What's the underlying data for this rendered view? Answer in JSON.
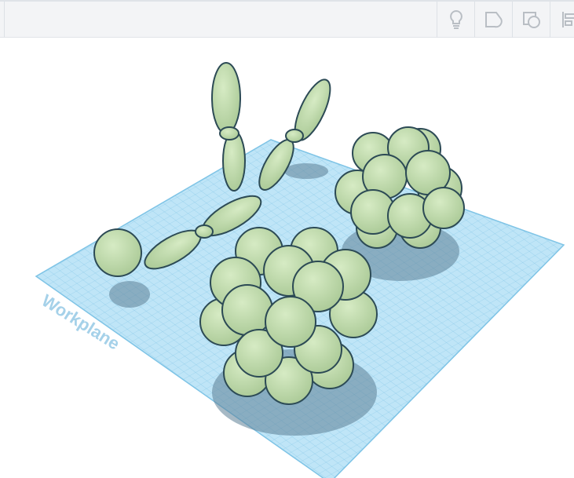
{
  "toolbar": {
    "icons": [
      "lightbulb-icon",
      "shape-note-icon",
      "group-shapes-icon",
      "align-icon"
    ]
  },
  "workplane": {
    "label": "Workplane"
  },
  "colors": {
    "shape_fill": "#c9e0b4",
    "shape_stroke": "#2c4a55",
    "grid": "#7fc4e6",
    "grid_bg": "#b8e2f6"
  }
}
